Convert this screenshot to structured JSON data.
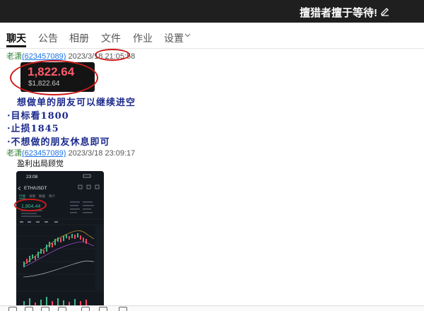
{
  "window": {
    "group_name": "擅猎者擅于等待!"
  },
  "tabs": [
    {
      "label": "聊天",
      "active": true
    },
    {
      "label": "公告"
    },
    {
      "label": "相册"
    },
    {
      "label": "文件"
    },
    {
      "label": "作业"
    },
    {
      "label": "设置"
    }
  ],
  "messages": [
    {
      "sender": "老潇",
      "qq": "(623457089)",
      "time": "2023/3/18 21:05:58",
      "price_card": {
        "price": "1,822.64",
        "sub_price": "$1,822.64"
      },
      "lines": [
        "想做单的朋友可以继续进空",
        "·目标看1800",
        "·止损1845",
        "·不想做的朋友休息即可"
      ]
    },
    {
      "sender": "老潇",
      "qq": "(623457089)",
      "time": "2023/3/18 23:09:17",
      "text": "盈利出局顾觉",
      "screenshot": {
        "status_time": "23:08",
        "pair": "ETH/USDT",
        "price": "1,804.44",
        "tabs": [
          "行情",
          "详情",
          "数据",
          "简介"
        ]
      }
    }
  ],
  "colors": {
    "accent_red": "#cc1b1b",
    "handwriting": "#1b2a8c",
    "sender_green": "#2e7d32",
    "link_blue": "#1a73e8"
  }
}
